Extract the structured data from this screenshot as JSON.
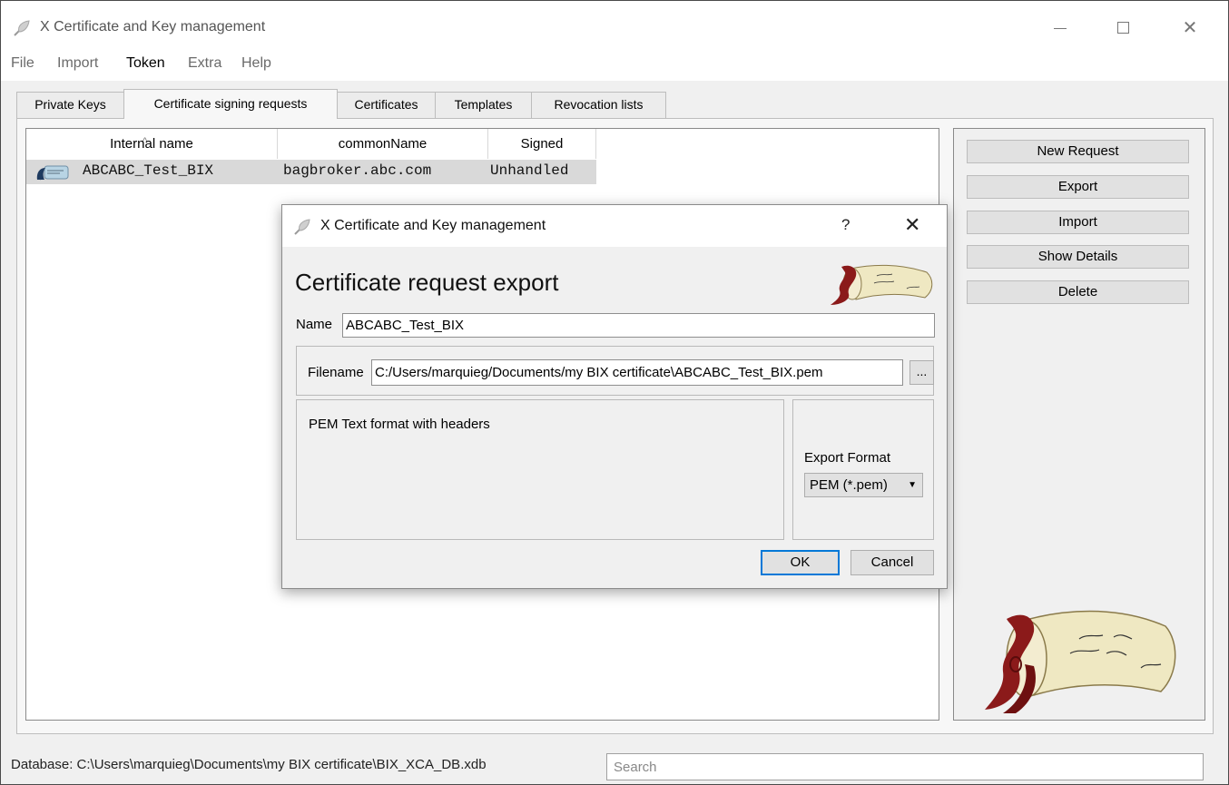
{
  "window": {
    "title": "X Certificate and Key management",
    "minimize_icon": "minimize-icon",
    "maximize_icon": "maximize-icon",
    "close_glyph": "✕"
  },
  "menu": [
    "File",
    "Import",
    "Token",
    "Extra",
    "Help"
  ],
  "tabs": [
    "Private Keys",
    "Certificate signing requests",
    "Certificates",
    "Templates",
    "Revocation lists"
  ],
  "table": {
    "sort_indicator": "^",
    "headers": [
      "Internal name",
      "commonName",
      "Signed"
    ],
    "rows": [
      {
        "icon": "certificate-request-icon",
        "internal_name": "ABCABC_Test_BIX",
        "common_name": "bagbroker.abc.com",
        "signed": "Unhandled"
      }
    ]
  },
  "side_buttons": [
    "New Request",
    "Export",
    "Import",
    "Show Details",
    "Delete"
  ],
  "side_logo": "parchment-scroll-logo",
  "status": {
    "database": "Database: C:\\Users\\marquieg\\Documents\\my BIX certificate\\BIX_XCA_DB.xdb",
    "search_placeholder": "Search"
  },
  "dialog": {
    "title": "X Certificate and Key management",
    "help_glyph": "?",
    "close_glyph": "✕",
    "heading": "Certificate request export",
    "name_label": "Name",
    "name_value": "ABCABC_Test_BIX",
    "filename_label": "Filename",
    "filename_value": "C:/Users/marquieg/Documents/my BIX certificate\\ABCABC_Test_BIX.pem",
    "browse_label": "...",
    "format_description": "PEM Text format with headers",
    "export_format_label": "Export Format",
    "export_format_value": "PEM (*.pem)",
    "ok_label": "OK",
    "cancel_label": "Cancel"
  },
  "colors": {
    "selection": "#d9d9d9",
    "default_button_border": "#0078d7",
    "scroll_red": "#8b1a1a",
    "parchment": "#efe8c2"
  }
}
